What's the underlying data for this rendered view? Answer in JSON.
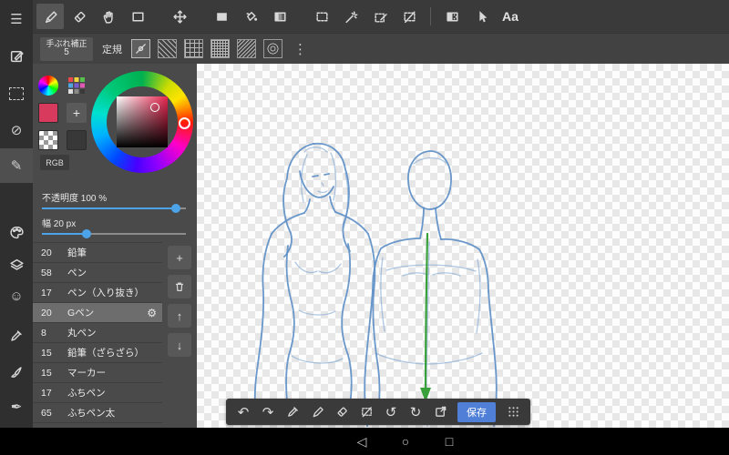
{
  "colors": {
    "accent_blue": "#4da3e8",
    "save_blue": "#4f7fd6",
    "sketch_blue": "#5e8fc7",
    "arrow_green": "#3aa13a",
    "current_color": "#d83a5e"
  },
  "glyphs": {
    "menu": "☰",
    "pencil": "✎",
    "deselect": "⊘",
    "smile": "☺",
    "pen_nib": "✒",
    "undo": "↶",
    "redo": "↷",
    "rotate_ccw": "↺",
    "rotate_cw": "↻",
    "gear": "⚙",
    "plus": "+",
    "up": "↑",
    "down": "↓",
    "dots": "⋮",
    "back": "◁",
    "home": "○",
    "recents": "□"
  },
  "top_toolbar": {
    "text_tool": "Aa"
  },
  "sub_toolbar": {
    "stabilizer_label": "手ぶれ補正",
    "stabilizer_value": "5",
    "ruler_label": "定規"
  },
  "color_panel": {
    "rgb_label": "RGB"
  },
  "brush_panel": {
    "opacity_label": "不透明度 100 %",
    "opacity_percent": 93,
    "width_label": "幅 20 px",
    "width_percent": 31,
    "selected_index": 3,
    "items": [
      {
        "size": "20",
        "name": "鉛筆"
      },
      {
        "size": "58",
        "name": "ペン"
      },
      {
        "size": "17",
        "name": "ペン（入り抜き）"
      },
      {
        "size": "20",
        "name": "Gペン"
      },
      {
        "size": "8",
        "name": "丸ペン"
      },
      {
        "size": "15",
        "name": "鉛筆（ざらざら）"
      },
      {
        "size": "15",
        "name": "マーカー"
      },
      {
        "size": "17",
        "name": "ふちペン"
      },
      {
        "size": "65",
        "name": "ふちペン太"
      }
    ]
  },
  "floating_bar": {
    "save_label": "保存"
  }
}
